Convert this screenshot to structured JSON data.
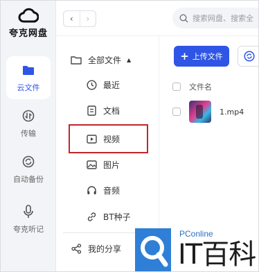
{
  "app": {
    "name": "夸克网盘",
    "accent": "#2e55e6"
  },
  "rail": {
    "items": [
      {
        "label": "云文件",
        "icon": "folder-icon",
        "active": true
      },
      {
        "label": "传输",
        "icon": "transfer-icon",
        "active": false
      },
      {
        "label": "自动备份",
        "icon": "backup-icon",
        "active": false
      },
      {
        "label": "夸克听记",
        "icon": "microphone-icon",
        "active": false
      }
    ]
  },
  "topbar": {
    "back": "‹",
    "forward": "›",
    "search_placeholder": "搜索网盘、搜索全"
  },
  "tree": {
    "root": {
      "label": "全部文件",
      "caret": "▲",
      "icon": "folder-outline-icon"
    },
    "children": [
      {
        "label": "最近",
        "icon": "clock-icon"
      },
      {
        "label": "文档",
        "icon": "document-icon"
      },
      {
        "label": "视频",
        "icon": "video-icon",
        "highlighted": true
      },
      {
        "label": "图片",
        "icon": "image-icon"
      },
      {
        "label": "音频",
        "icon": "headphones-icon"
      },
      {
        "label": "BT种子",
        "icon": "link-icon"
      }
    ],
    "share": {
      "label": "我的分享",
      "icon": "share-icon"
    }
  },
  "main": {
    "upload_label": "上传文件",
    "column_header": "文件名",
    "files": [
      {
        "name": "1.mp4",
        "type": "video"
      }
    ]
  },
  "watermark": {
    "small": "PConline",
    "big": "IT百科"
  }
}
